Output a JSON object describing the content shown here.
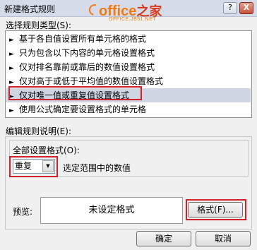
{
  "window": {
    "title": "新建格式规则",
    "help_symbol": "?",
    "close_symbol": "X"
  },
  "watermark": {
    "logo_text": "office",
    "logo_cn": "之家",
    "url": "OFFICE.JB51.NET",
    "brand_color": "#f07b10"
  },
  "rule_type": {
    "label": "选择规则类型(S):",
    "items": [
      {
        "label": "基于各自值设置所有单元格的格式",
        "selected": false
      },
      {
        "label": "只为包含以下内容的单元格设置格式",
        "selected": false
      },
      {
        "label": "仅对排名靠前或靠后的数值设置格式",
        "selected": false
      },
      {
        "label": "仅对高于或低于平均值的数值设置格式",
        "selected": false
      },
      {
        "label": "仅对唯一值或重复值设置格式",
        "selected": true
      },
      {
        "label": "使用公式确定要设置格式的单元格",
        "selected": false
      }
    ]
  },
  "rule_desc": {
    "label": "编辑规则说明(E):",
    "format_all_label": "全部设置格式(O):",
    "combo_value": "重复",
    "combo_suffix": "选定范围中的数值",
    "preview_label": "预览:",
    "preview_text": "未设定格式",
    "format_button": "格式(F)..."
  },
  "footer": {
    "ok": "确定",
    "cancel": "取消"
  },
  "highlight_color": "#d3212b"
}
